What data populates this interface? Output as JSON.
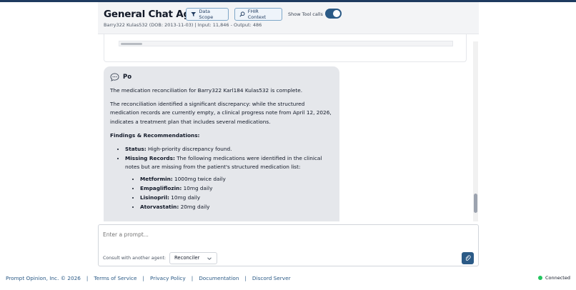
{
  "header": {
    "title": "General Chat Agent",
    "subtitle": "Barry322 Kulas532 (DOB: 2013-11-03)  | Input: 11,846 - Output: 486",
    "data_scope_label": "Data Scope",
    "fhir_context_label": "FHIR Context",
    "show_tool_calls_label": "Show Tool calls",
    "show_tool_calls_on": true
  },
  "message": {
    "agent_name": "Po",
    "p1": "The medication reconciliation for Barry322 Karl184 Kulas532 is complete.",
    "p2": "The reconciliation identified a significant discrepancy: while the structured medication records are currently empty, a clinical progress note from April 12, 2026, indicates a treatment plan that includes several medications.",
    "findings_heading": "Findings & Recommendations:",
    "status_label": "Status:",
    "status_text": " High-priority discrepancy found.",
    "missing_label": "Missing Records:",
    "missing_text": " The following medications were identified in the clinical notes but are missing from the patient's structured medication list:",
    "meds": [
      {
        "name": "Metformin:",
        "dose": " 1000mg twice daily"
      },
      {
        "name": "Empagliflozin:",
        "dose": " 10mg daily"
      },
      {
        "name": "Lisinopril:",
        "dose": " 10mg daily"
      },
      {
        "name": "Atorvastatin:",
        "dose": " 20mg daily"
      }
    ]
  },
  "composer": {
    "placeholder": "Enter a prompt...",
    "consult_label": "Consult with another agent:",
    "consult_selected": "Reconciler"
  },
  "footer": {
    "copyright": "Prompt Opinion, Inc. © 2026",
    "terms": "Terms of Service",
    "privacy": "Privacy Policy",
    "docs": "Documentation",
    "discord": "Discord Server",
    "status": "Connected"
  },
  "colors": {
    "brand": "#2b5a86",
    "bubble_bg": "#e5e7eb",
    "status_green": "#22c55e"
  }
}
